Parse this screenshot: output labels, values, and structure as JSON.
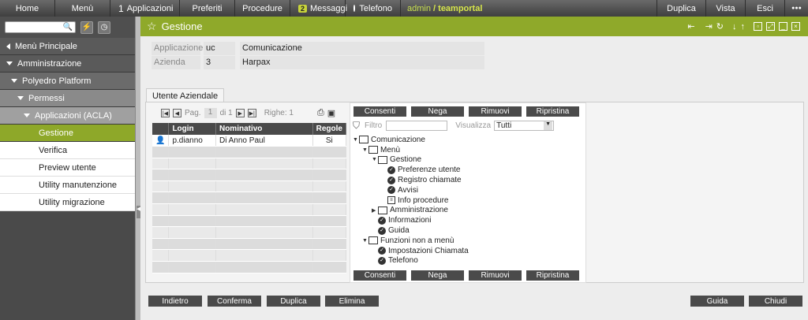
{
  "topbar": {
    "home": "Home",
    "menu": "Menù",
    "apps_count": "1",
    "apps": "Applicazioni",
    "favorites": "Preferiti",
    "procedures": "Procedure",
    "messages_count": "2",
    "messages": "Messaggi",
    "phone": "Telefono",
    "user": "admin",
    "separator": "/",
    "portal": "teamportal",
    "duplicate": "Duplica",
    "view": "Vista",
    "exit": "Esci",
    "more": "●●●"
  },
  "sidebar": {
    "items": [
      {
        "label": "Menù Principale"
      },
      {
        "label": "Amministrazione"
      },
      {
        "label": "Polyedro Platform"
      },
      {
        "label": "Permessi"
      },
      {
        "label": "Applicazioni (ACLA)"
      },
      {
        "label": "Gestione"
      },
      {
        "label": "Verifica"
      },
      {
        "label": "Preview utente"
      },
      {
        "label": "Utility manutenzione"
      },
      {
        "label": "Utility migrazione"
      }
    ]
  },
  "page": {
    "title": "Gestione"
  },
  "header": {
    "app_label": "Applicazione",
    "app_code": "uc",
    "app_desc": "Comunicazione",
    "company_label": "Azienda",
    "company_code": "3",
    "company_desc": "Harpax"
  },
  "tab": {
    "label": "Utente Aziendale"
  },
  "pager": {
    "page_label": "Pag.",
    "page_num": "1",
    "of": "di 1",
    "rows": "Righe: 1"
  },
  "grid": {
    "columns": [
      "Login",
      "Nominativo",
      "Regole"
    ],
    "rows": [
      {
        "login": "p.dianno",
        "name": "Di Anno Paul",
        "rules": "Si"
      }
    ]
  },
  "actions": {
    "grant": "Consenti",
    "deny": "Nega",
    "remove": "Rimuovi",
    "restore": "Ripristina"
  },
  "filter": {
    "label": "Filtro",
    "view_label": "Visualizza",
    "view_value": "Tutti"
  },
  "tree": [
    {
      "label": "Comunicazione",
      "level": 0,
      "icon": "folder",
      "arrow": "▼"
    },
    {
      "label": "Menù",
      "level": 1,
      "icon": "folder",
      "arrow": "▼"
    },
    {
      "label": "Gestione",
      "level": 2,
      "icon": "folder",
      "arrow": "▼"
    },
    {
      "label": "Preferenze utente",
      "level": 3,
      "icon": "check",
      "arrow": ""
    },
    {
      "label": "Registro chiamate",
      "level": 3,
      "icon": "check",
      "arrow": ""
    },
    {
      "label": "Avvisi",
      "level": 3,
      "icon": "check",
      "arrow": ""
    },
    {
      "label": "Info procedure",
      "level": 3,
      "icon": "doc",
      "arrow": ""
    },
    {
      "label": "Amministrazione",
      "level": 2,
      "icon": "folder",
      "arrow": "▶"
    },
    {
      "label": "Informazioni",
      "level": 2,
      "icon": "check",
      "arrow": ""
    },
    {
      "label": "Guida",
      "level": 2,
      "icon": "check",
      "arrow": ""
    },
    {
      "label": "Funzioni non a menù",
      "level": 1,
      "icon": "folder",
      "arrow": "▼"
    },
    {
      "label": "Impostazioni Chiamata",
      "level": 2,
      "icon": "check",
      "arrow": ""
    },
    {
      "label": "Telefono",
      "level": 2,
      "icon": "check",
      "arrow": ""
    }
  ],
  "bottom": {
    "back": "Indietro",
    "confirm": "Conferma",
    "duplicate": "Duplica",
    "delete": "Elimina",
    "help": "Guida",
    "close": "Chiudi"
  }
}
